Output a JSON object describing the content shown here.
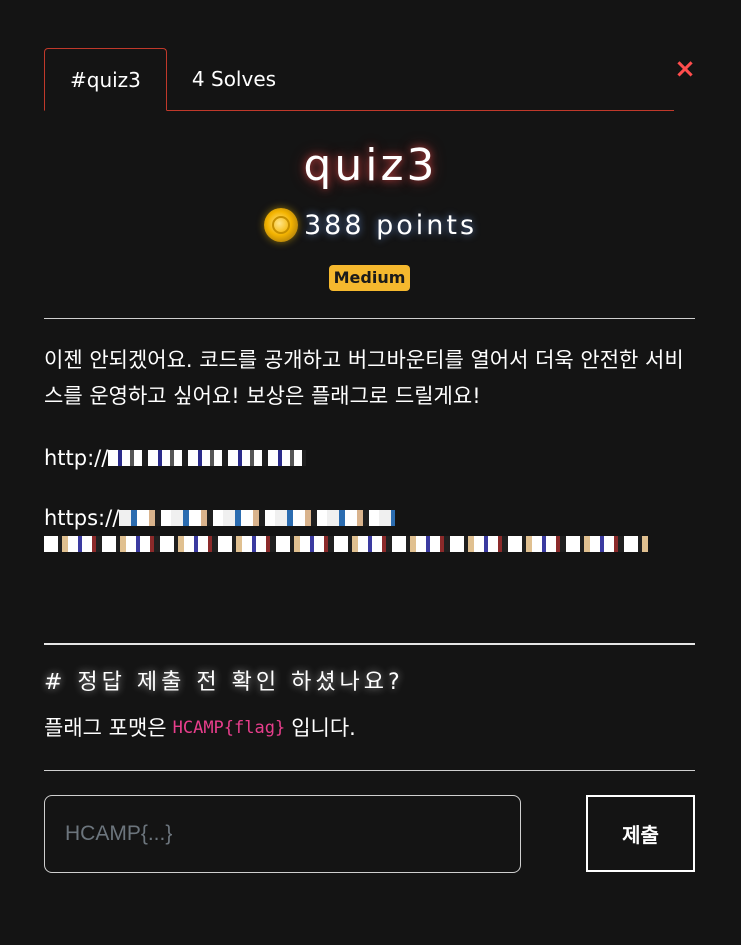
{
  "tabs": [
    {
      "label": "#quiz3",
      "active": true
    },
    {
      "label": "4 Solves",
      "active": false
    }
  ],
  "close_label": "×",
  "challenge": {
    "title": "quiz3",
    "points": "388 points",
    "difficulty": "Medium"
  },
  "description": {
    "text": "이젠 안되겠어요. 코드를 공개하고 버그바운티를 열어서 더욱 안전한 서비스를 운영하고 싶어요! 보상은 플래그로 드릴게요!",
    "link1_prefix": "http://",
    "link2_prefix": "https://"
  },
  "notice": {
    "heading": "# 정답 제출 전 확인 하셨나요?",
    "format_prefix": "플래그 포맷은",
    "format_code": "HCAMP{flag}",
    "format_suffix": "입니다."
  },
  "submit": {
    "placeholder": "HCAMP{...}",
    "button_label": "제출"
  },
  "colors": {
    "background": "#141414",
    "tab_border": "#c0392b",
    "badge": "#f5b82e",
    "code": "#e83e8c"
  }
}
